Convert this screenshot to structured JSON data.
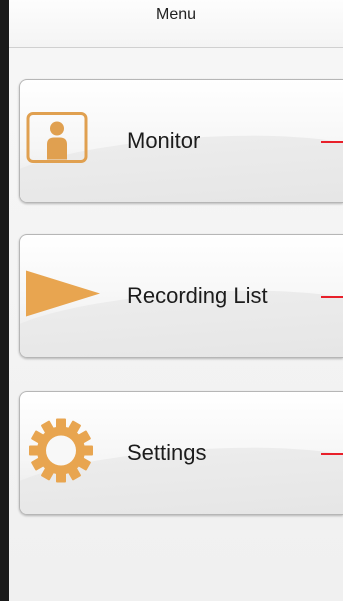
{
  "header": {
    "title": "Menu"
  },
  "menu": {
    "items": [
      {
        "label": "Monitor",
        "icon": "person-icon"
      },
      {
        "label": "Recording List",
        "icon": "play-icon"
      },
      {
        "label": "Settings",
        "icon": "gear-icon"
      }
    ]
  },
  "colors": {
    "icon_accent": "#e0a050",
    "indicator": "#e8202a"
  }
}
